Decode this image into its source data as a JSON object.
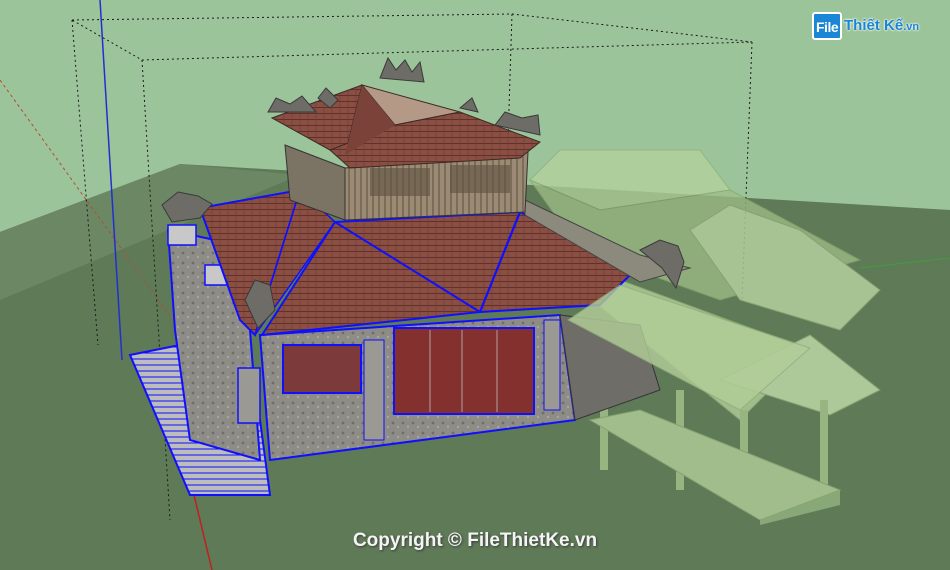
{
  "watermark": {
    "logo_box_text": "File",
    "logo_text": "Thiết Kế",
    "logo_tld": ".vn",
    "copyright": "Copyright © FileThietKe.vn"
  },
  "colors": {
    "sky": "#9cc49a",
    "ground": "#5f7a57",
    "roof_tile": "#8a4e43",
    "wall_stone": "#8d8c86",
    "selection_outline": "#1010ff",
    "ghost_model": "#a9c98f",
    "logo_blue": "#1b86d6"
  },
  "scene": {
    "model_name": "",
    "view": "3D perspective with selected component (blue outline) and faded hidden geometry"
  }
}
